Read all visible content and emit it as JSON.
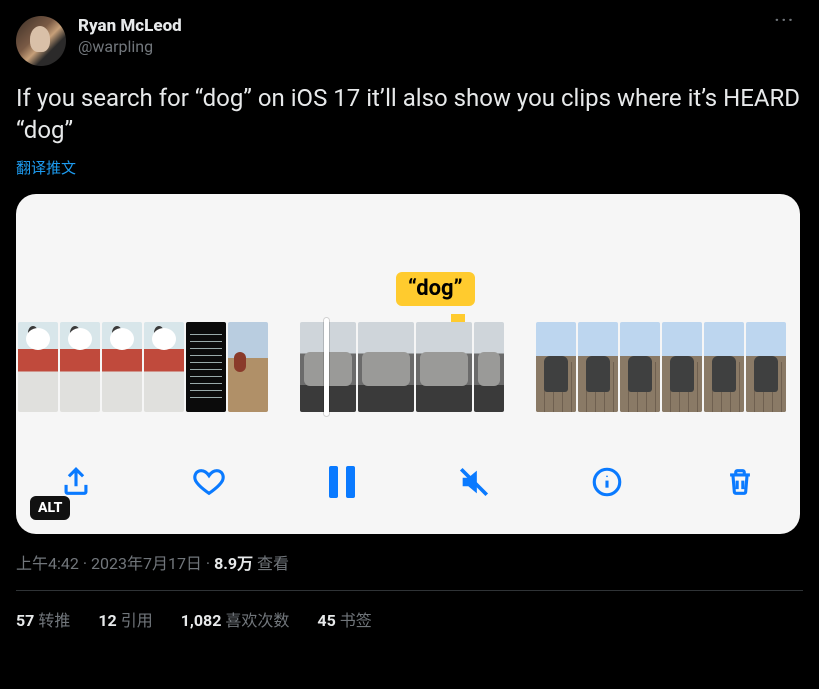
{
  "author": {
    "display_name": "Ryan McLeod",
    "handle": "@warpling"
  },
  "more_label": "···",
  "body_text": "If you search for “dog” on iOS 17 it’ll also show you clips where it’s HEARD “dog”",
  "translate_label": "翻译推文",
  "media": {
    "bubble_text": "“dog”",
    "alt_badge": "ALT",
    "toolbar": {
      "share": "share",
      "like": "like",
      "pause": "pause",
      "mute": "mute",
      "info": "info",
      "delete": "delete"
    }
  },
  "meta": {
    "time": "上午4:42",
    "sep1": " · ",
    "date": "2023年7月17日",
    "sep2": " · ",
    "views_count": "8.9万",
    "views_label": " 查看"
  },
  "stats": {
    "retweets": {
      "count": "57",
      "label": "转推"
    },
    "quotes": {
      "count": "12",
      "label": "引用"
    },
    "likes": {
      "count": "1,082",
      "label": "喜欢次数"
    },
    "bookmarks": {
      "count": "45",
      "label": "书签"
    }
  }
}
